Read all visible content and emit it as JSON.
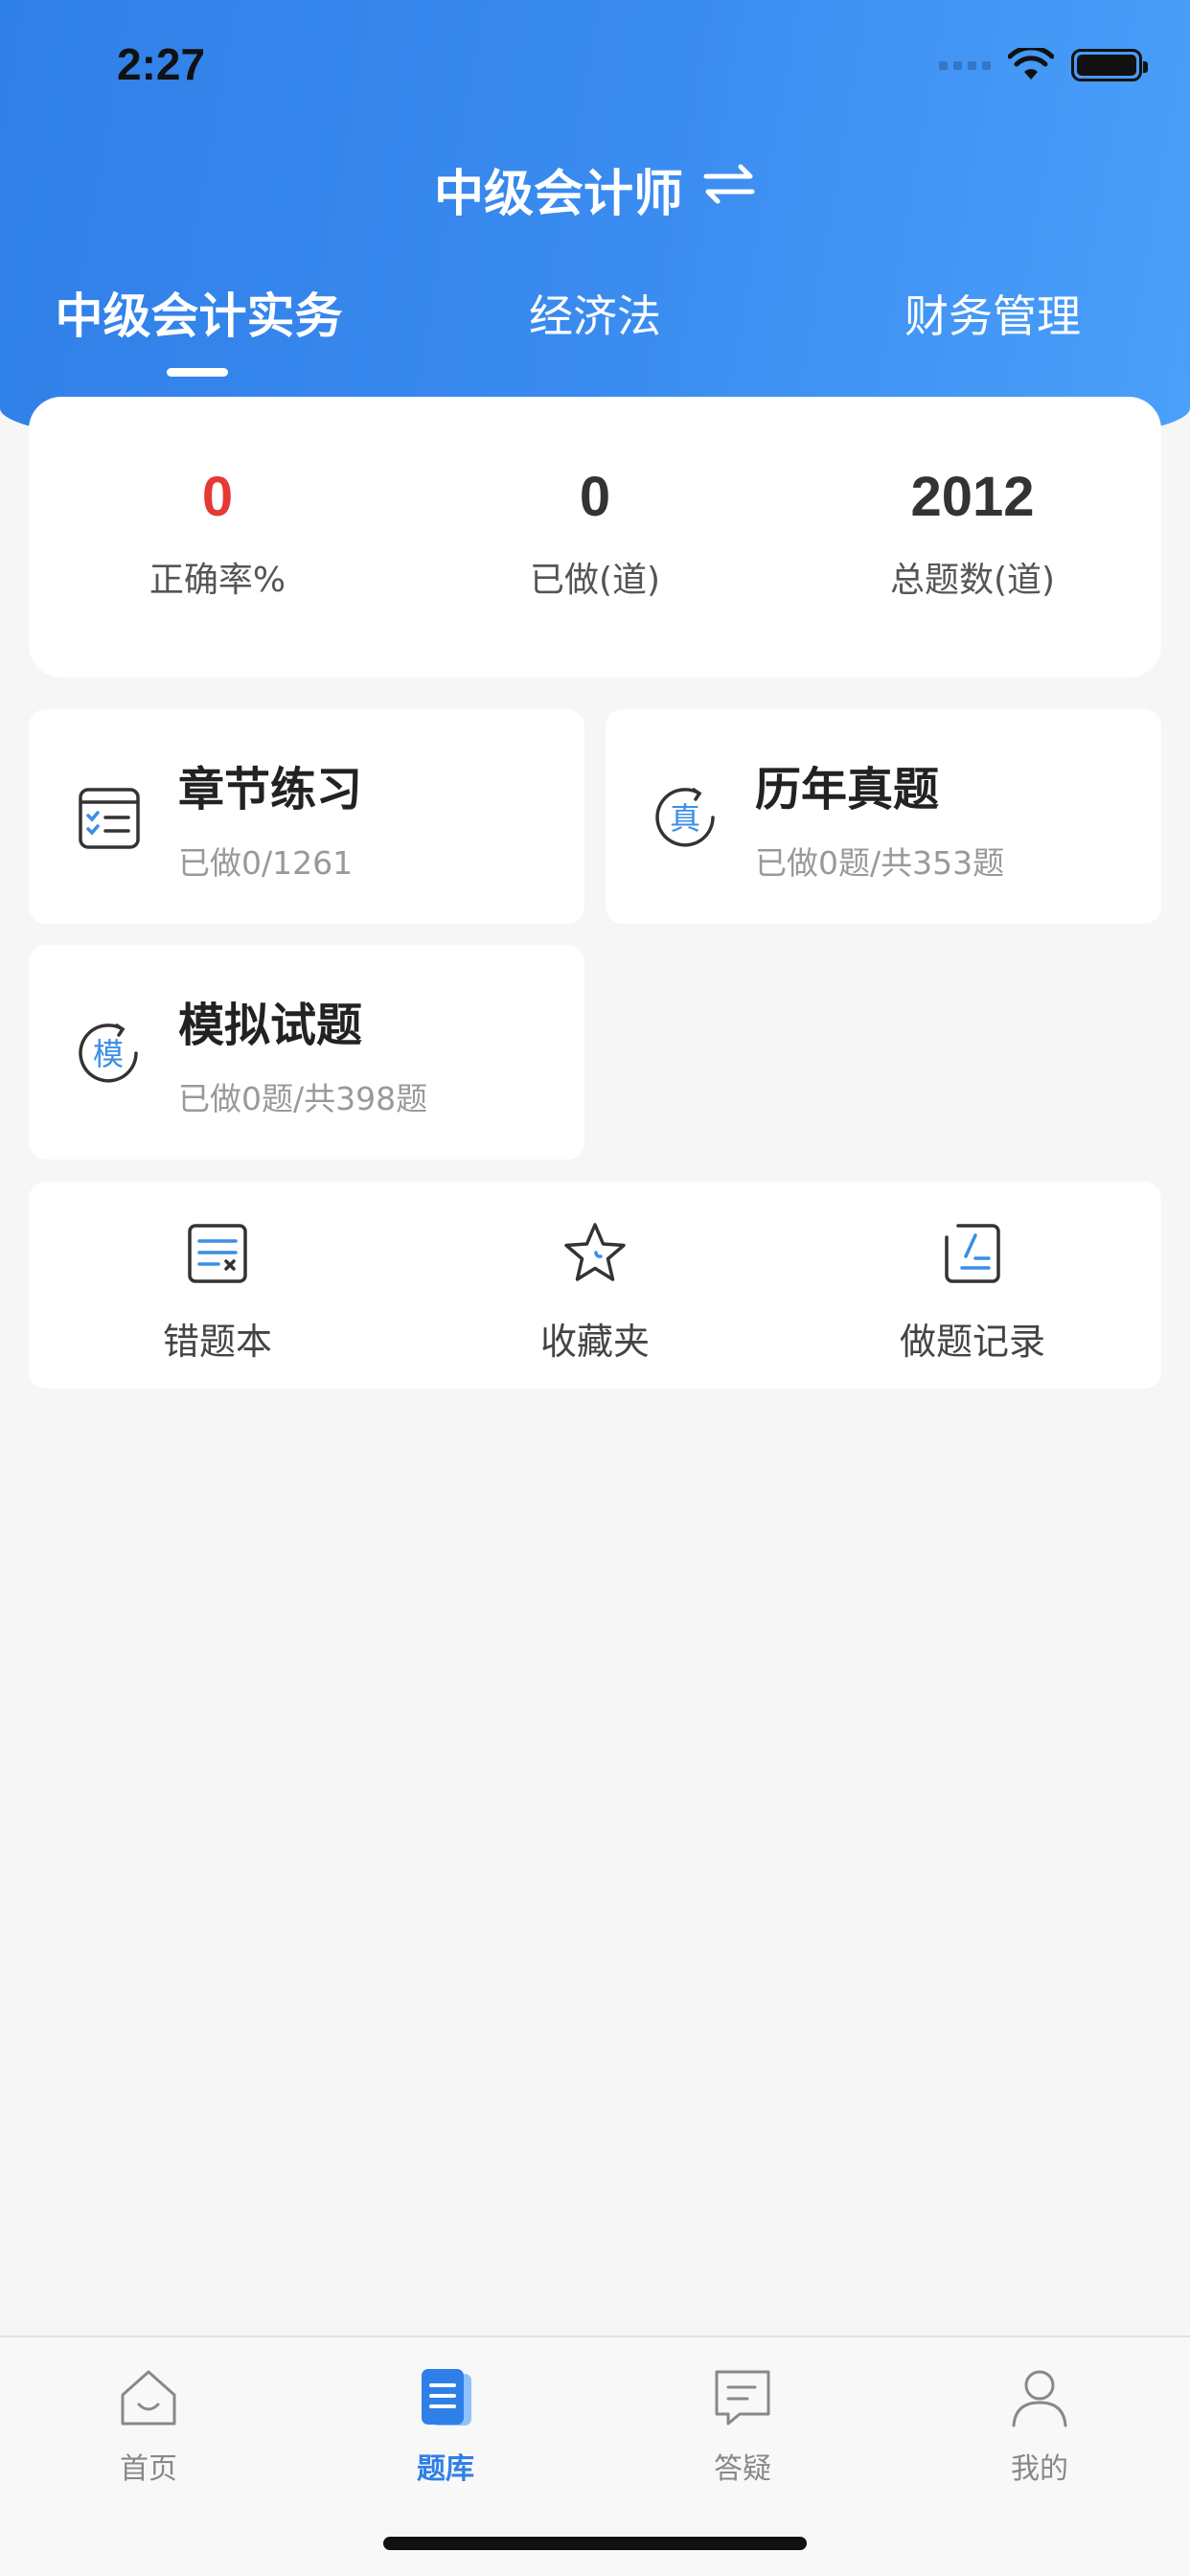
{
  "status_bar": {
    "time": "2:27"
  },
  "header": {
    "title": "中级会计师",
    "tabs": [
      {
        "label": "中级会计实务",
        "active": true
      },
      {
        "label": "经济法",
        "active": false
      },
      {
        "label": "财务管理",
        "active": false
      }
    ]
  },
  "stats": [
    {
      "value": "0",
      "label": "正确率%"
    },
    {
      "value": "0",
      "label": "已做(道)"
    },
    {
      "value": "2012",
      "label": "总题数(道)"
    }
  ],
  "modules": [
    {
      "title": "章节练习",
      "subtitle": "已做0/1261",
      "icon": "checklist-icon"
    },
    {
      "title": "历年真题",
      "subtitle": "已做0题/共353题",
      "icon": "zhen-icon",
      "icon_char": "真"
    },
    {
      "title": "模拟试题",
      "subtitle": "已做0题/共398题",
      "icon": "mo-icon",
      "icon_char": "模"
    }
  ],
  "tools": [
    {
      "label": "错题本",
      "icon": "wrong-notebook-icon"
    },
    {
      "label": "收藏夹",
      "icon": "star-icon"
    },
    {
      "label": "做题记录",
      "icon": "record-icon"
    }
  ],
  "bottom_nav": [
    {
      "label": "首页",
      "icon": "home-icon",
      "active": false
    },
    {
      "label": "题库",
      "icon": "question-bank-icon",
      "active": true
    },
    {
      "label": "答疑",
      "icon": "chat-icon",
      "active": false
    },
    {
      "label": "我的",
      "icon": "user-icon",
      "active": false
    }
  ],
  "colors": {
    "accent": "#2f7fe8",
    "header_end": "#4aa0fa",
    "stat_red": "#e53935",
    "icon_blue": "#3a8ee6"
  }
}
